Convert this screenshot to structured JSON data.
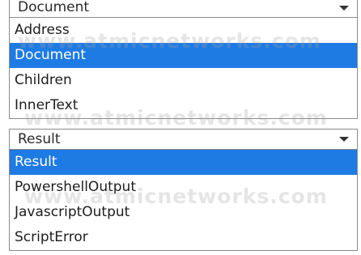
{
  "dropdown_top": {
    "selected_value": "Document",
    "icon": "chevron-down-icon",
    "options": [
      {
        "label": "Address",
        "selected": false
      },
      {
        "label": "Document",
        "selected": true
      },
      {
        "label": "Children",
        "selected": false
      },
      {
        "label": "InnerText",
        "selected": false
      }
    ]
  },
  "dropdown_bottom": {
    "selected_value": "Result",
    "icon": "chevron-down-icon",
    "options": [
      {
        "label": "Result",
        "selected": true
      },
      {
        "label": "PowershellOutput",
        "selected": false
      },
      {
        "label": "JavascriptOutput",
        "selected": false
      },
      {
        "label": "ScriptError",
        "selected": false
      }
    ]
  },
  "watermark": "www.atmicnetworks.com",
  "colors": {
    "selection": "#1e7be3",
    "border": "#8a8a8a",
    "text": "#1d1d1d"
  }
}
